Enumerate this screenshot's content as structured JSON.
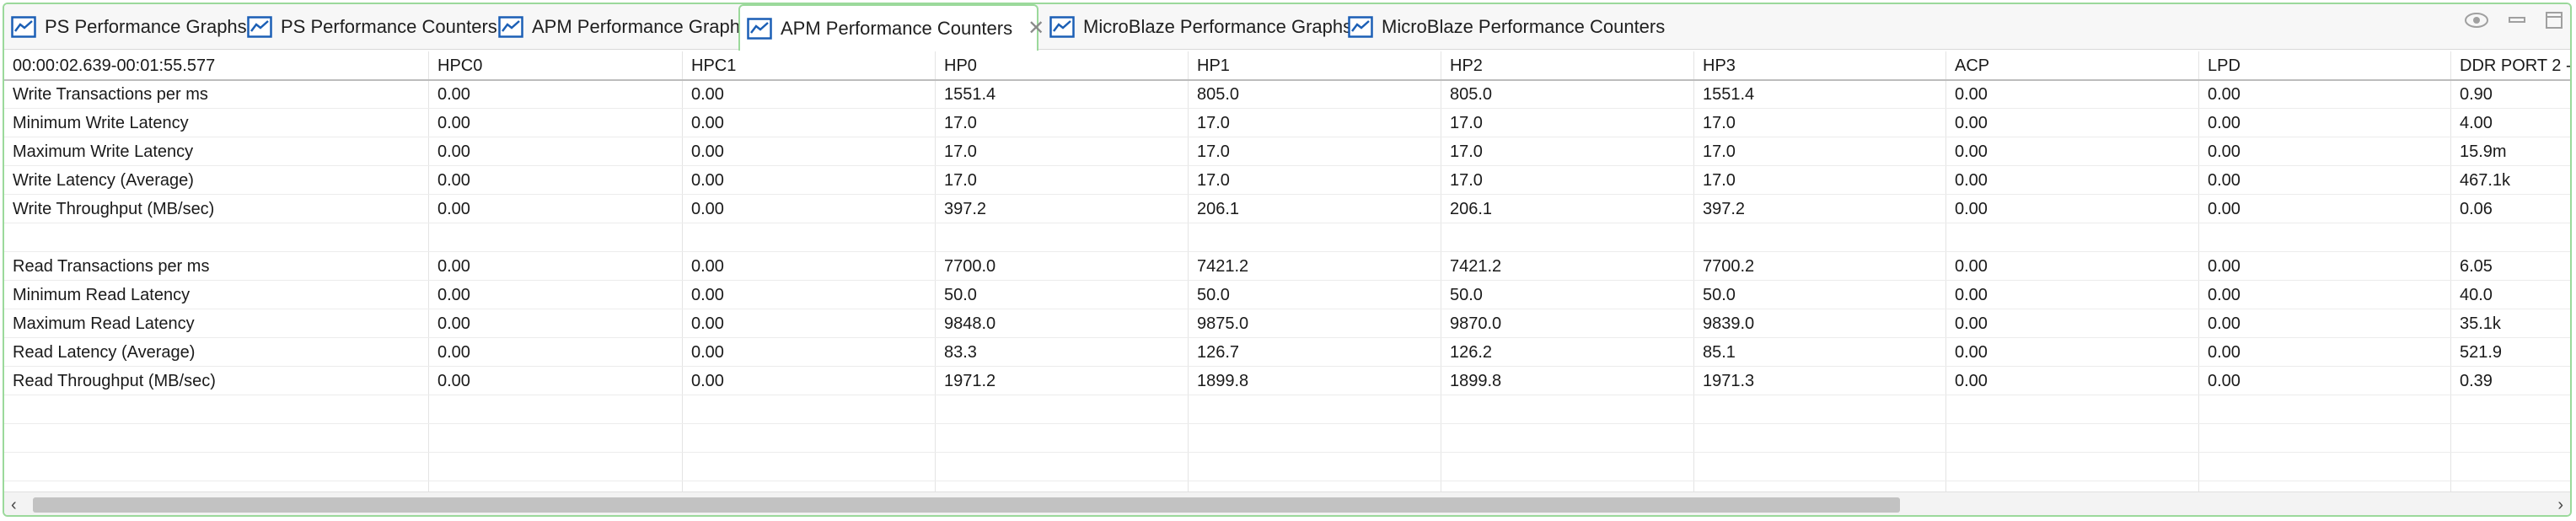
{
  "colors": {
    "accent": "#1b5fb5",
    "active_border": "#9bd99b"
  },
  "tabs": [
    {
      "label": "PS Performance Graphs",
      "icon": "chart-icon",
      "active": false
    },
    {
      "label": "PS Performance Counters",
      "icon": "chart-icon",
      "active": false
    },
    {
      "label": "APM Performance Graphs",
      "icon": "chart-icon",
      "active": false
    },
    {
      "label": "APM Performance Counters",
      "icon": "chart-icon",
      "active": true
    },
    {
      "label": "MicroBlaze Performance Graphs",
      "icon": "chart-icon",
      "active": false
    },
    {
      "label": "MicroBlaze Performance Counters",
      "icon": "chart-icon",
      "active": false
    }
  ],
  "view_controls": [
    "eye-icon",
    "minimize-icon",
    "maximize-icon"
  ],
  "table": {
    "columns": [
      "00:00:02.639-00:01:55.577",
      "HPC0",
      "HPC1",
      "HP0",
      "HP1",
      "HP2",
      "HP3",
      "ACP",
      "LPD",
      "DDR PORT 2 -"
    ],
    "rows": [
      [
        "Write Transactions per ms",
        "0.00",
        "0.00",
        "1551.4",
        "805.0",
        "805.0",
        "1551.4",
        "0.00",
        "0.00",
        "0.90"
      ],
      [
        "Minimum Write Latency",
        "0.00",
        "0.00",
        "17.0",
        "17.0",
        "17.0",
        "17.0",
        "0.00",
        "0.00",
        "4.00"
      ],
      [
        "Maximum Write Latency",
        "0.00",
        "0.00",
        "17.0",
        "17.0",
        "17.0",
        "17.0",
        "0.00",
        "0.00",
        "15.9m"
      ],
      [
        "Write Latency (Average)",
        "0.00",
        "0.00",
        "17.0",
        "17.0",
        "17.0",
        "17.0",
        "0.00",
        "0.00",
        "467.1k"
      ],
      [
        "Write Throughput (MB/sec)",
        "0.00",
        "0.00",
        "397.2",
        "206.1",
        "206.1",
        "397.2",
        "0.00",
        "0.00",
        "0.06"
      ],
      [
        "",
        "",
        "",
        "",
        "",
        "",
        "",
        "",
        "",
        ""
      ],
      [
        "Read Transactions per ms",
        "0.00",
        "0.00",
        "7700.0",
        "7421.2",
        "7421.2",
        "7700.2",
        "0.00",
        "0.00",
        "6.05"
      ],
      [
        "Minimum Read Latency",
        "0.00",
        "0.00",
        "50.0",
        "50.0",
        "50.0",
        "50.0",
        "0.00",
        "0.00",
        "40.0"
      ],
      [
        "Maximum Read Latency",
        "0.00",
        "0.00",
        "9848.0",
        "9875.0",
        "9870.0",
        "9839.0",
        "0.00",
        "0.00",
        "35.1k"
      ],
      [
        "Read Latency (Average)",
        "0.00",
        "0.00",
        "83.3",
        "126.7",
        "126.2",
        "85.1",
        "0.00",
        "0.00",
        "521.9"
      ],
      [
        "Read Throughput (MB/sec)",
        "0.00",
        "0.00",
        "1971.2",
        "1899.8",
        "1899.8",
        "1971.3",
        "0.00",
        "0.00",
        "0.39"
      ],
      [
        "",
        "",
        "",
        "",
        "",
        "",
        "",
        "",
        "",
        ""
      ],
      [
        "",
        "",
        "",
        "",
        "",
        "",
        "",
        "",
        "",
        ""
      ],
      [
        "",
        "",
        "",
        "",
        "",
        "",
        "",
        "",
        "",
        ""
      ]
    ]
  },
  "scrollbar": {
    "left_arrow": "‹",
    "right_arrow": "›"
  }
}
